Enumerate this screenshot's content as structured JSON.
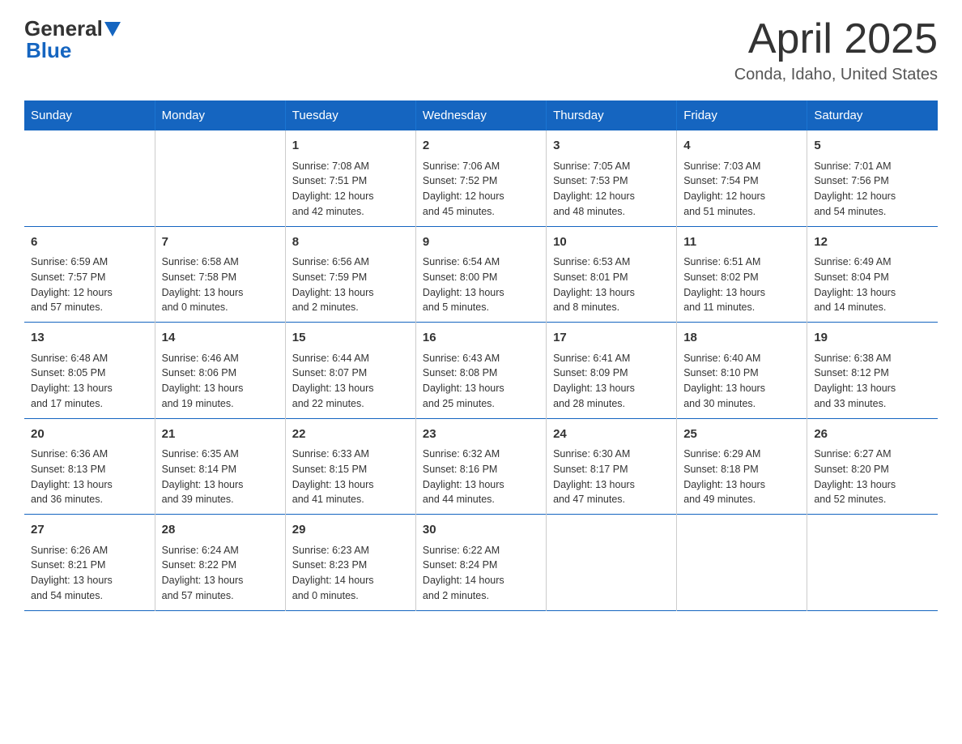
{
  "header": {
    "logo_general": "General",
    "logo_blue": "Blue",
    "title": "April 2025",
    "location": "Conda, Idaho, United States"
  },
  "weekdays": [
    "Sunday",
    "Monday",
    "Tuesday",
    "Wednesday",
    "Thursday",
    "Friday",
    "Saturday"
  ],
  "weeks": [
    [
      {
        "day": "",
        "info": ""
      },
      {
        "day": "",
        "info": ""
      },
      {
        "day": "1",
        "info": "Sunrise: 7:08 AM\nSunset: 7:51 PM\nDaylight: 12 hours\nand 42 minutes."
      },
      {
        "day": "2",
        "info": "Sunrise: 7:06 AM\nSunset: 7:52 PM\nDaylight: 12 hours\nand 45 minutes."
      },
      {
        "day": "3",
        "info": "Sunrise: 7:05 AM\nSunset: 7:53 PM\nDaylight: 12 hours\nand 48 minutes."
      },
      {
        "day": "4",
        "info": "Sunrise: 7:03 AM\nSunset: 7:54 PM\nDaylight: 12 hours\nand 51 minutes."
      },
      {
        "day": "5",
        "info": "Sunrise: 7:01 AM\nSunset: 7:56 PM\nDaylight: 12 hours\nand 54 minutes."
      }
    ],
    [
      {
        "day": "6",
        "info": "Sunrise: 6:59 AM\nSunset: 7:57 PM\nDaylight: 12 hours\nand 57 minutes."
      },
      {
        "day": "7",
        "info": "Sunrise: 6:58 AM\nSunset: 7:58 PM\nDaylight: 13 hours\nand 0 minutes."
      },
      {
        "day": "8",
        "info": "Sunrise: 6:56 AM\nSunset: 7:59 PM\nDaylight: 13 hours\nand 2 minutes."
      },
      {
        "day": "9",
        "info": "Sunrise: 6:54 AM\nSunset: 8:00 PM\nDaylight: 13 hours\nand 5 minutes."
      },
      {
        "day": "10",
        "info": "Sunrise: 6:53 AM\nSunset: 8:01 PM\nDaylight: 13 hours\nand 8 minutes."
      },
      {
        "day": "11",
        "info": "Sunrise: 6:51 AM\nSunset: 8:02 PM\nDaylight: 13 hours\nand 11 minutes."
      },
      {
        "day": "12",
        "info": "Sunrise: 6:49 AM\nSunset: 8:04 PM\nDaylight: 13 hours\nand 14 minutes."
      }
    ],
    [
      {
        "day": "13",
        "info": "Sunrise: 6:48 AM\nSunset: 8:05 PM\nDaylight: 13 hours\nand 17 minutes."
      },
      {
        "day": "14",
        "info": "Sunrise: 6:46 AM\nSunset: 8:06 PM\nDaylight: 13 hours\nand 19 minutes."
      },
      {
        "day": "15",
        "info": "Sunrise: 6:44 AM\nSunset: 8:07 PM\nDaylight: 13 hours\nand 22 minutes."
      },
      {
        "day": "16",
        "info": "Sunrise: 6:43 AM\nSunset: 8:08 PM\nDaylight: 13 hours\nand 25 minutes."
      },
      {
        "day": "17",
        "info": "Sunrise: 6:41 AM\nSunset: 8:09 PM\nDaylight: 13 hours\nand 28 minutes."
      },
      {
        "day": "18",
        "info": "Sunrise: 6:40 AM\nSunset: 8:10 PM\nDaylight: 13 hours\nand 30 minutes."
      },
      {
        "day": "19",
        "info": "Sunrise: 6:38 AM\nSunset: 8:12 PM\nDaylight: 13 hours\nand 33 minutes."
      }
    ],
    [
      {
        "day": "20",
        "info": "Sunrise: 6:36 AM\nSunset: 8:13 PM\nDaylight: 13 hours\nand 36 minutes."
      },
      {
        "day": "21",
        "info": "Sunrise: 6:35 AM\nSunset: 8:14 PM\nDaylight: 13 hours\nand 39 minutes."
      },
      {
        "day": "22",
        "info": "Sunrise: 6:33 AM\nSunset: 8:15 PM\nDaylight: 13 hours\nand 41 minutes."
      },
      {
        "day": "23",
        "info": "Sunrise: 6:32 AM\nSunset: 8:16 PM\nDaylight: 13 hours\nand 44 minutes."
      },
      {
        "day": "24",
        "info": "Sunrise: 6:30 AM\nSunset: 8:17 PM\nDaylight: 13 hours\nand 47 minutes."
      },
      {
        "day": "25",
        "info": "Sunrise: 6:29 AM\nSunset: 8:18 PM\nDaylight: 13 hours\nand 49 minutes."
      },
      {
        "day": "26",
        "info": "Sunrise: 6:27 AM\nSunset: 8:20 PM\nDaylight: 13 hours\nand 52 minutes."
      }
    ],
    [
      {
        "day": "27",
        "info": "Sunrise: 6:26 AM\nSunset: 8:21 PM\nDaylight: 13 hours\nand 54 minutes."
      },
      {
        "day": "28",
        "info": "Sunrise: 6:24 AM\nSunset: 8:22 PM\nDaylight: 13 hours\nand 57 minutes."
      },
      {
        "day": "29",
        "info": "Sunrise: 6:23 AM\nSunset: 8:23 PM\nDaylight: 14 hours\nand 0 minutes."
      },
      {
        "day": "30",
        "info": "Sunrise: 6:22 AM\nSunset: 8:24 PM\nDaylight: 14 hours\nand 2 minutes."
      },
      {
        "day": "",
        "info": ""
      },
      {
        "day": "",
        "info": ""
      },
      {
        "day": "",
        "info": ""
      }
    ]
  ]
}
